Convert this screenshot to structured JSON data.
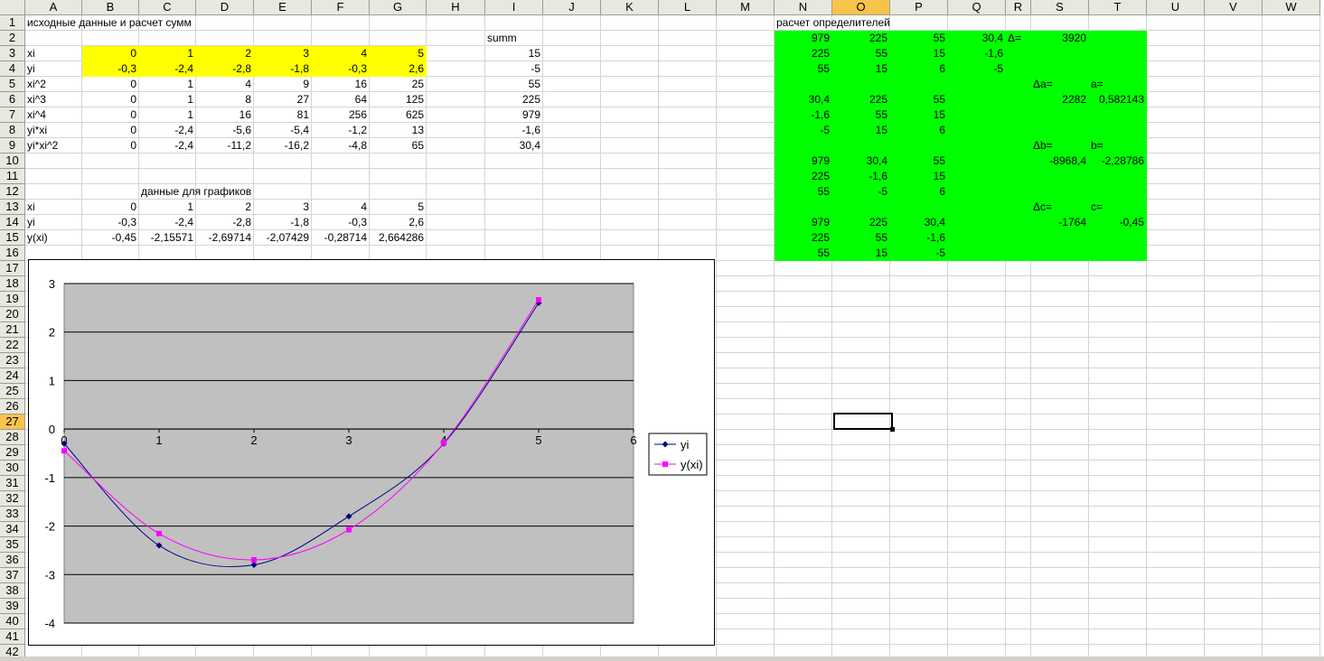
{
  "sheet": {
    "columns": [
      "A",
      "B",
      "C",
      "D",
      "E",
      "F",
      "G",
      "H",
      "I",
      "J",
      "K",
      "L",
      "M",
      "N",
      "O",
      "P",
      "Q",
      "R",
      "S",
      "T",
      "U",
      "V",
      "W"
    ],
    "rows": [
      "1",
      "2",
      "3",
      "4",
      "5",
      "6",
      "7",
      "8",
      "9",
      "10",
      "11",
      "12",
      "13",
      "14",
      "15",
      "16",
      "17",
      "18",
      "19",
      "20",
      "21",
      "22",
      "23",
      "24",
      "25",
      "26",
      "27",
      "28",
      "29",
      "30",
      "31",
      "32",
      "33",
      "34",
      "35",
      "36",
      "37",
      "38",
      "39",
      "40",
      "41",
      "42"
    ],
    "selected_column": "O",
    "selected_row": "27"
  },
  "cells": {
    "A1": "исходные данные и расчет сумм",
    "A3": "xi",
    "B3": "0",
    "C3": "1",
    "D3": "2",
    "E3": "3",
    "F3": "4",
    "G3": "5",
    "A4": "yi",
    "B4": "-0,3",
    "C4": "-2,4",
    "D4": "-2,8",
    "E4": "-1,8",
    "F4": "-0,3",
    "G4": "2,6",
    "A5": "xi^2",
    "B5": "0",
    "C5": "1",
    "D5": "4",
    "E5": "9",
    "F5": "16",
    "G5": "25",
    "A6": "xi^3",
    "B6": "0",
    "C6": "1",
    "D6": "8",
    "E6": "27",
    "F6": "64",
    "G6": "125",
    "A7": "xi^4",
    "B7": "0",
    "C7": "1",
    "D7": "16",
    "E7": "81",
    "F7": "256",
    "G7": "625",
    "A8": "yi*xi",
    "B8": "0",
    "C8": "-2,4",
    "D8": "-5,6",
    "E8": "-5,4",
    "F8": "-1,2",
    "G8": "13",
    "A9": "yi*xi^2",
    "B9": "0",
    "C9": "-2,4",
    "D9": "-11,2",
    "E9": "-16,2",
    "F9": "-4,8",
    "G9": "65",
    "I2": "summ",
    "I3": "15",
    "I4": "-5",
    "I5": "55",
    "I6": "225",
    "I7": "979",
    "I8": "-1,6",
    "I9": "30,4",
    "C12": "данные для графиков",
    "A13": "xi",
    "B13": "0",
    "C13": "1",
    "D13": "2",
    "E13": "3",
    "F13": "4",
    "G13": "5",
    "A14": "yi",
    "B14": "-0,3",
    "C14": "-2,4",
    "D14": "-2,8",
    "E14": "-1,8",
    "F14": "-0,3",
    "G14": "2,6",
    "A15": "y(xi)",
    "B15": "-0,45",
    "C15": "-2,15571",
    "D15": "-2,69714",
    "E15": "-2,07429",
    "F15": "-0,28714",
    "G15": "2,664286",
    "N1": "расчет  определителей",
    "N2": "979",
    "O2": "225",
    "P2": "55",
    "Q2": "30,4",
    "R2": "Δ=",
    "S2": "3920",
    "N3": "225",
    "O3": "55",
    "P3": "15",
    "Q3": "-1,6",
    "N4": "55",
    "O4": "15",
    "P4": "6",
    "Q4": "-5",
    "S5": "Δa=",
    "T5": "a=",
    "N6": "30,4",
    "O6": "225",
    "P6": "55",
    "S6": "2282",
    "T6": "0,582143",
    "N7": "-1,6",
    "O7": "55",
    "P7": "15",
    "N8": "-5",
    "O8": "15",
    "P8": "6",
    "S9": "Δb=",
    "T9": "b=",
    "N10": "979",
    "O10": "30,4",
    "P10": "55",
    "S10": "-8968,4",
    "T10": "-2,28786",
    "N11": "225",
    "O11": "-1,6",
    "P11": "15",
    "N12": "55",
    "O12": "-5",
    "P12": "6",
    "S13": "Δc=",
    "T13": "c=",
    "N14": "979",
    "O14": "225",
    "P14": "30,4",
    "S14": "-1764",
    "T14": "-0,45",
    "N15": "225",
    "O15": "55",
    "P15": "-1,6",
    "N16": "55",
    "O16": "15",
    "P16": "-5"
  },
  "colors": {
    "yellow_fill": "#ffff00",
    "green_fill": "#00ff00",
    "plot_bg": "#c0c0c0",
    "series_yi": "#000080",
    "series_yxi": "#ff00ff",
    "header_selected": "#f7c44b"
  },
  "chart_data": {
    "type": "scatter",
    "smooth": true,
    "series": [
      {
        "name": "yi",
        "x": [
          0,
          1,
          2,
          3,
          4,
          5
        ],
        "y": [
          -0.3,
          -2.4,
          -2.8,
          -1.8,
          -0.3,
          2.6
        ],
        "marker": "diamond",
        "color": "#000080"
      },
      {
        "name": "y(xi)",
        "x": [
          0,
          1,
          2,
          3,
          4,
          5
        ],
        "y": [
          -0.45,
          -2.15571,
          -2.69714,
          -2.07429,
          -0.28714,
          2.664286
        ],
        "marker": "square",
        "color": "#ff00ff"
      }
    ],
    "xlim": [
      0,
      6
    ],
    "ylim": [
      -4,
      3
    ],
    "xticks": [
      "0",
      "1",
      "2",
      "3",
      "4",
      "5",
      "6"
    ],
    "yticks": [
      "3",
      "2",
      "1",
      "0",
      "-1",
      "-2",
      "-3",
      "-4"
    ],
    "grid": true,
    "legend_position": "right"
  }
}
